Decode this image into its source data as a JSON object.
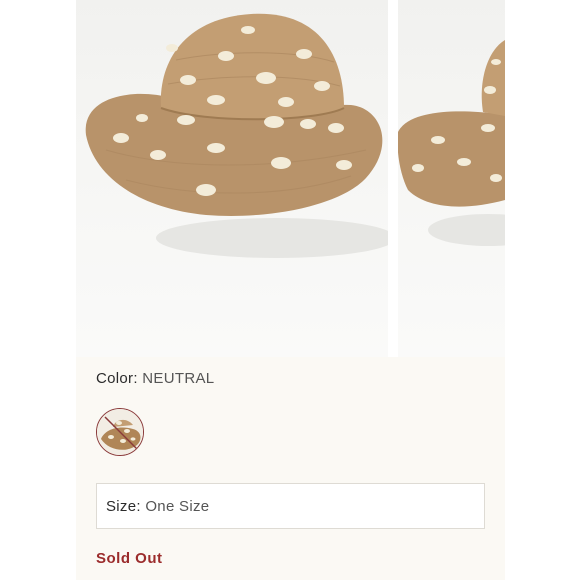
{
  "product": {
    "color_label": "Color:",
    "color_value": "NEUTRAL",
    "size_label": "Size:",
    "size_value": "One Size",
    "availability": "Sold Out"
  },
  "gallery": {
    "images": [
      "straw-hat-front",
      "straw-hat-side"
    ],
    "hat_color": "#b8936a",
    "dot_color": "#f3ecd9"
  },
  "swatch": {
    "selected_color": "NEUTRAL",
    "ring_color": "#8a3a3a",
    "unavailable": true
  },
  "colors": {
    "background": "#fbf9f4",
    "sold_out": "#9b2c2c"
  }
}
